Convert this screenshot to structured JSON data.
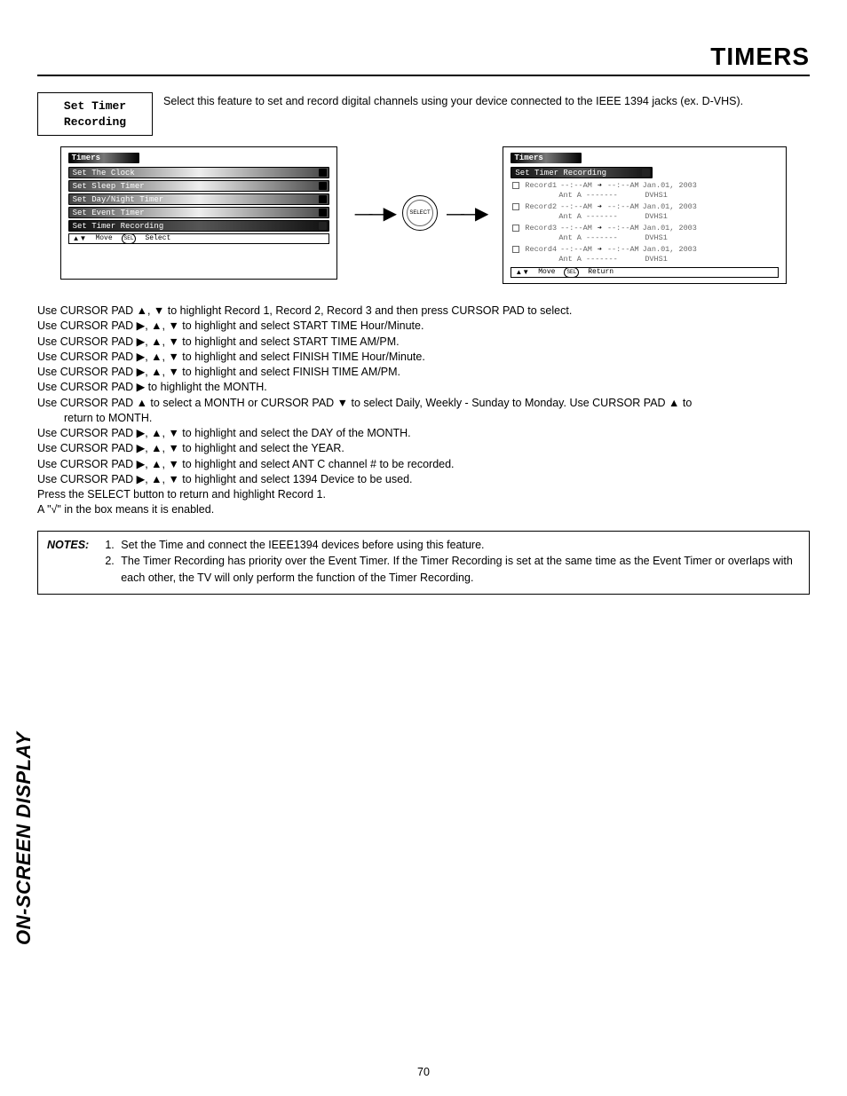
{
  "page": {
    "title": "TIMERS",
    "number": "70",
    "side_label": "ON-SCREEN DISPLAY"
  },
  "feature": {
    "line1": "Set Timer",
    "line2": "Recording"
  },
  "intro": "Select this feature to set and record digital channels using your device connected to the IEEE 1394 jacks (ex. D-VHS).",
  "osd_left": {
    "header": "Timers",
    "items": [
      "Set The Clock",
      "Set Sleep Timer",
      "Set Day/Night Timer",
      "Set Event Timer",
      "Set Timer Recording"
    ],
    "footer_move": "Move",
    "footer_sel": "SEL",
    "footer_select": "Select"
  },
  "select_button": "SELECT",
  "osd_right": {
    "header": "Timers",
    "sub_header": "Set Timer Recording",
    "records": [
      {
        "label": "Record1",
        "t1": "--:--AM",
        "t2": "--:--AM",
        "date": "Jan.01, 2003",
        "ant": "Ant A -------",
        "dev": "DVHS1"
      },
      {
        "label": "Record2",
        "t1": "--:--AM",
        "t2": "--:--AM",
        "date": "Jan.01, 2003",
        "ant": "Ant A -------",
        "dev": "DVHS1"
      },
      {
        "label": "Record3",
        "t1": "--:--AM",
        "t2": "--:--AM",
        "date": "Jan.01, 2003",
        "ant": "Ant A -------",
        "dev": "DVHS1"
      },
      {
        "label": "Record4",
        "t1": "--:--AM",
        "t2": "--:--AM",
        "date": "Jan.01, 2003",
        "ant": "Ant A -------",
        "dev": "DVHS1"
      }
    ],
    "footer_move": "Move",
    "footer_sel": "SEL",
    "footer_return": "Return"
  },
  "steps": {
    "s1": "Use CURSOR PAD ▲, ▼ to highlight Record 1, Record 2, Record 3 and then press CURSOR PAD to select.",
    "s2": "Use CURSOR PAD ▶, ▲, ▼ to highlight and select START TIME Hour/Minute.",
    "s3": "Use CURSOR PAD ▶, ▲, ▼ to highlight and select START TIME AM/PM.",
    "s4": "Use CURSOR PAD ▶, ▲, ▼ to highlight and select FINISH TIME Hour/Minute.",
    "s5": "Use CURSOR PAD ▶, ▲, ▼ to highlight and select FINISH TIME AM/PM.",
    "s6": "Use CURSOR PAD ▶ to highlight the MONTH.",
    "s7a": "Use CURSOR PAD ▲ to select a MONTH or CURSOR PAD ▼ to select Daily, Weekly - Sunday to Monday.  Use CURSOR PAD ▲ to",
    "s7b": "return to MONTH.",
    "s8": "Use CURSOR PAD ▶, ▲, ▼ to highlight and select the DAY of the MONTH.",
    "s9": "Use CURSOR PAD ▶, ▲, ▼ to highlight and select the YEAR.",
    "s10": "Use CURSOR PAD ▶, ▲, ▼ to highlight and select ANT C channel # to be recorded.",
    "s11": "Use CURSOR PAD ▶, ▲, ▼ to highlight and select 1394 Device to be used.",
    "s12": "Press the SELECT button to return and highlight Record 1.",
    "s13": "A \"√\" in the box means it is enabled."
  },
  "notes": {
    "label": "NOTES:",
    "items": [
      "Set the Time and connect the IEEE1394 devices before using this feature.",
      "The Timer Recording has priority over the Event Timer.  If the Timer Recording is set at the same time as the Event Timer or overlaps with each other, the TV will only perform the function of the Timer Recording."
    ]
  }
}
